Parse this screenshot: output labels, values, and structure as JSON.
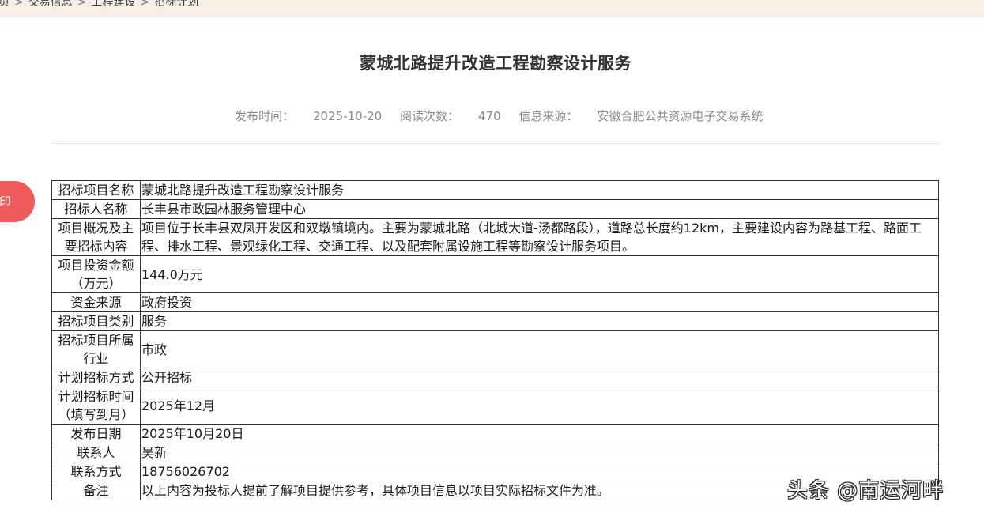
{
  "breadcrumb": {
    "items": [
      "页",
      "交易信息",
      "工程建设",
      "招标计划"
    ]
  },
  "side_tab": {
    "label": "印"
  },
  "article": {
    "title": "蒙城北路提升改造工程勘察设计服务",
    "meta": {
      "publish_label": "发布时间：",
      "publish_value": "2025-10-20",
      "reads_label": "阅读次数：",
      "reads_value": "470",
      "source_label": "信息来源：",
      "source_value": "安徽合肥公共资源电子交易系统"
    }
  },
  "table": {
    "rows": [
      {
        "key": "招标项目名称",
        "value": "蒙城北路提升改造工程勘察设计服务"
      },
      {
        "key": "招标人名称",
        "value": "长丰县市政园林服务管理中心"
      },
      {
        "key": "项目概况及主要招标内容",
        "value": "项目位于长丰县双凤开发区和双墩镇境内。主要为蒙城北路（北城大道-汤都路段），道路总长度约12km，主要建设内容为路基工程、路面工程、排水工程、景观绿化工程、交通工程、以及配套附属设施工程等勘察设计服务项目。"
      },
      {
        "key": "项目投资金额（万元）",
        "value": "144.0万元"
      },
      {
        "key": "资金来源",
        "value": "政府投资"
      },
      {
        "key": "招标项目类别",
        "value": "服务"
      },
      {
        "key": "招标项目所属行业",
        "value": "市政"
      },
      {
        "key": "计划招标方式",
        "value": "公开招标"
      },
      {
        "key": "计划招标时间（填写到月）",
        "value": "2025年12月"
      },
      {
        "key": "发布日期",
        "value": "2025年10月20日"
      },
      {
        "key": "联系人",
        "value": "吴新"
      },
      {
        "key": "联系方式",
        "value": "18756026702"
      },
      {
        "key": "备注",
        "value": "以上内容为投标人提前了解项目提供参考，具体项目信息以项目实际招标文件为准。"
      }
    ]
  },
  "watermark": {
    "text": "头条 @南运河畔"
  }
}
